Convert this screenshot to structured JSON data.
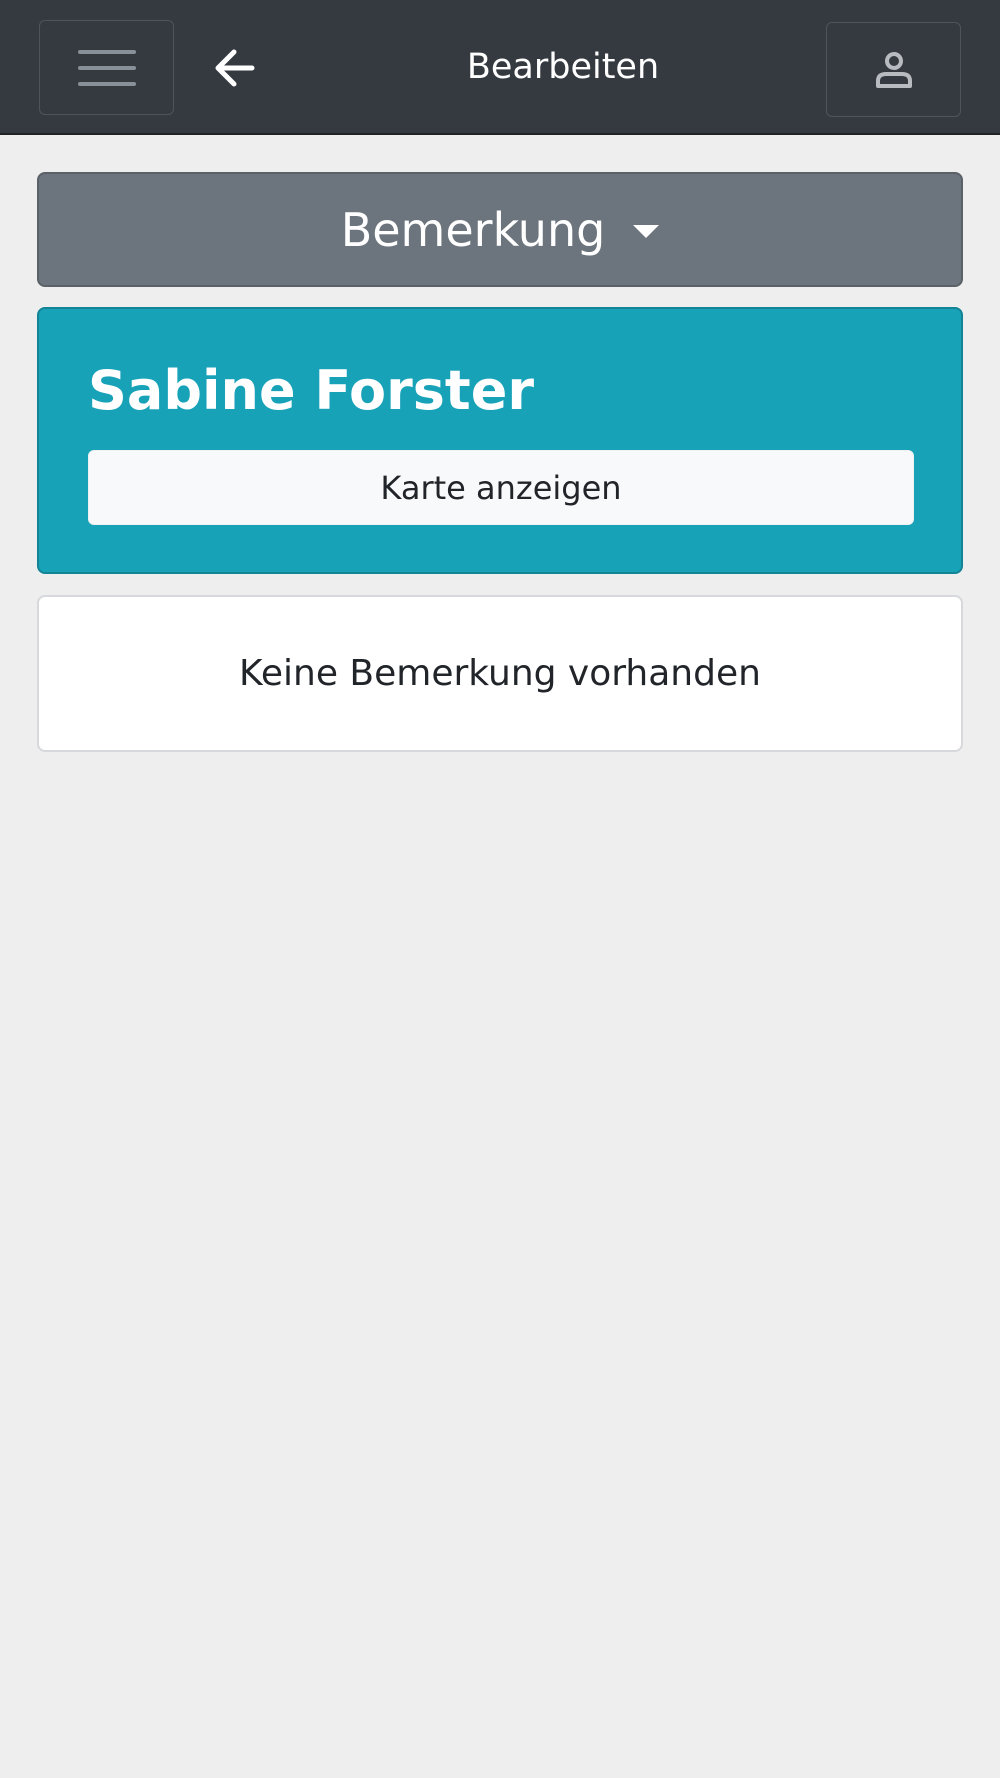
{
  "header": {
    "title": "Bearbeiten",
    "menu_icon": "hamburger-menu-icon",
    "back_icon": "arrow-left-icon",
    "user_icon": "user-icon"
  },
  "section_selector": {
    "selected": "Bemerkung",
    "icon": "caret-down-icon"
  },
  "contact_card": {
    "name": "Sabine Forster",
    "map_button_label": "Karte anzeigen"
  },
  "remark": {
    "empty_text": "Keine Bemerkung vorhanden"
  },
  "colors": {
    "topbar": "#343a40",
    "dropdown": "#6c757d",
    "card": "#17a2b8",
    "background": "#eeeeee"
  }
}
